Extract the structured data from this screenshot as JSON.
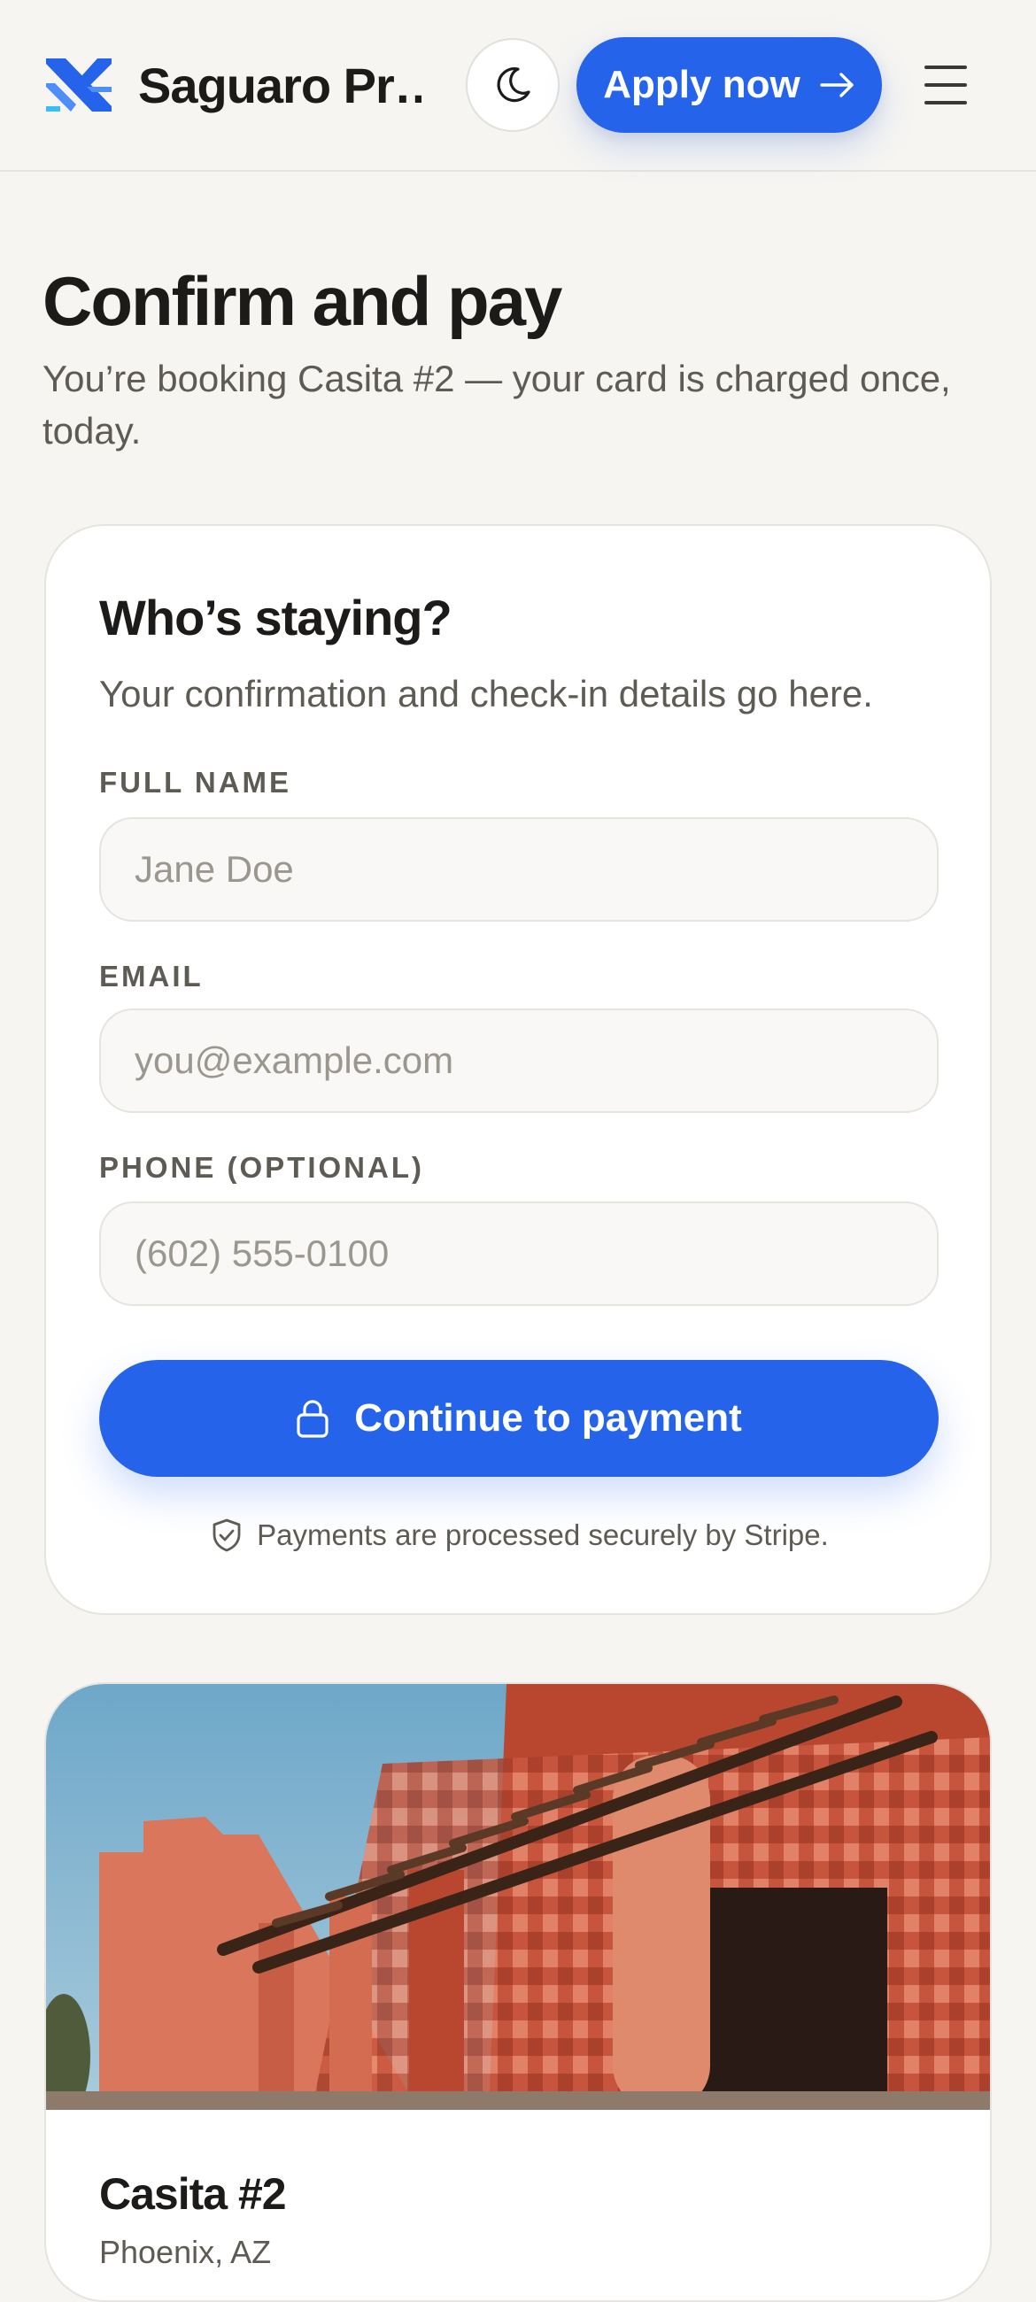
{
  "header": {
    "brand": "Saguaro Pr…",
    "apply_label": "Apply now",
    "icons": {
      "logo": "logo-mark",
      "theme": "moon-icon",
      "arrow": "arrow-right-icon",
      "menu": "hamburger-icon"
    }
  },
  "page": {
    "title": "Confirm and pay",
    "subtitle": "You’re booking Casita #2 — your card is charged once, today."
  },
  "form": {
    "title": "Who’s staying?",
    "description": "Your confirmation and check-in details go here.",
    "fields": [
      {
        "label": "FULL NAME",
        "placeholder": "Jane Doe",
        "value": ""
      },
      {
        "label": "EMAIL",
        "placeholder": "you@example.com",
        "value": ""
      },
      {
        "label": "PHONE (OPTIONAL)",
        "placeholder": "(602) 555-0100",
        "value": ""
      }
    ],
    "submit_label": "Continue to payment",
    "secure_note": "Payments are processed securely by Stripe."
  },
  "listing": {
    "name": "Casita #2",
    "location": "Phoenix, AZ"
  },
  "colors": {
    "accent": "#2563eb",
    "background": "#f6f5f2",
    "text": "#1c1b19",
    "muted": "#5e5b55"
  }
}
